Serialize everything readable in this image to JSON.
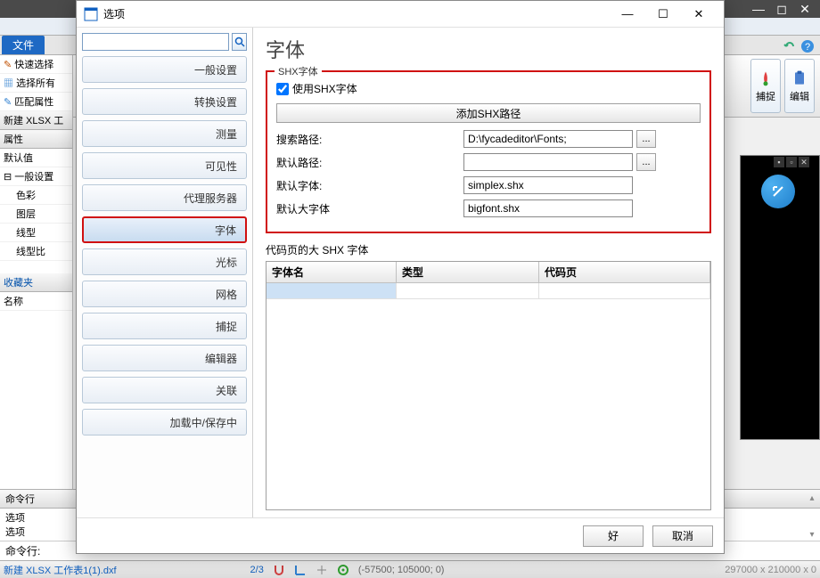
{
  "main_window": {
    "file_tab": "文件",
    "menu_icons": [
      "icon-a",
      "icon-plus",
      "icon-doc"
    ],
    "ribbon": {
      "capture": "捕捉",
      "edit": "编辑"
    },
    "left_panel": {
      "quick_select": "快速选择",
      "select_all": "选择所有",
      "match_props": "匹配属性",
      "new_xlsx": "新建 XLSX 工",
      "props_hdr": "属性",
      "default_val": "默认值",
      "general_settings": "一般设置",
      "items": [
        "色彩",
        "图层",
        "线型",
        "线型比"
      ],
      "favorites": "收藏夹",
      "name": "名称",
      "cmd_hdr": "命令行",
      "cmd_lines": [
        "选项",
        "选项"
      ],
      "cmd_prompt": "命令行:"
    },
    "status": {
      "file": "新建 XLSX 工作表1(1).dxf",
      "frac": "2/3",
      "coord": "(-57500; 105000; 0)",
      "dims": "297000 x 210000 x 0"
    }
  },
  "dialog": {
    "title": "选项",
    "categories": [
      "一般设置",
      "转换设置",
      "测量",
      "可见性",
      "代理服务器",
      "字体",
      "光标",
      "网格",
      "捕捉",
      "编辑器",
      "关联",
      "加载中/保存中"
    ],
    "selected_index": 5,
    "page": {
      "title": "字体",
      "shx_group": {
        "label": "SHX字体",
        "use_shx": "使用SHX字体",
        "use_shx_checked": true,
        "add_path_btn": "添加SHX路径",
        "rows": {
          "search_path_label": "搜索路径:",
          "search_path_value": "D:\\fycadeditor\\Fonts;",
          "default_path_label": "默认路径:",
          "default_path_value": "",
          "default_font_label": "默认字体:",
          "default_font_value": "simplex.shx",
          "default_big_label": "默认大字体",
          "default_big_value": "bigfont.shx"
        }
      },
      "codepage": {
        "label": "代码页的大 SHX 字体",
        "cols": [
          "字体名",
          "类型",
          "代码页"
        ]
      }
    },
    "buttons": {
      "ok": "好",
      "cancel": "取消"
    }
  }
}
